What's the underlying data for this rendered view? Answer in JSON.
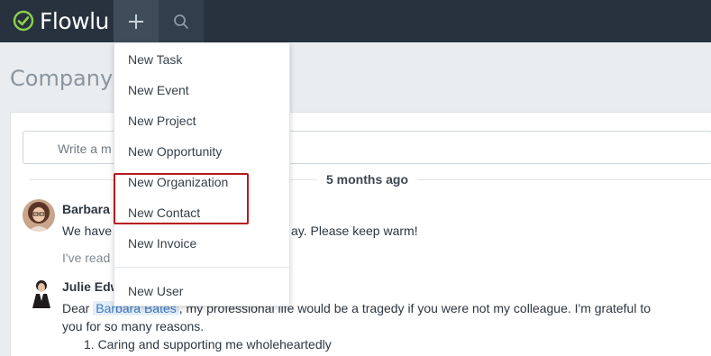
{
  "app": {
    "name": "Flowlu"
  },
  "page": {
    "title": "Company Fe"
  },
  "post_input": {
    "placeholder": "Write a m"
  },
  "feed": {
    "date_label": "5 months ago",
    "posts": [
      {
        "author": "Barbara",
        "message": "We have",
        "message_tail": "ay. Please keep warm!",
        "reply_snippet": "I've read"
      },
      {
        "author": "Julie Edw",
        "line1_prefix": "Dear",
        "mention": "Barbara Bates",
        "line1_rest": ", my professional life would be a tragedy if you were not my colleague. I'm grateful to",
        "line2": "you for so many reasons.",
        "list_item": "1. Caring and supporting me wholeheartedly"
      }
    ]
  },
  "create_menu": {
    "items": [
      {
        "label": "New Task"
      },
      {
        "label": "New Event"
      },
      {
        "label": "New Project"
      },
      {
        "label": "New Opportunity"
      },
      {
        "label": "New Organization"
      },
      {
        "label": "New Contact"
      },
      {
        "label": "New Invoice"
      },
      {
        "label": "New User"
      }
    ]
  },
  "colors": {
    "topbar": "#27323e",
    "accent_green": "#8ed14b",
    "highlight": "#b5181e"
  }
}
